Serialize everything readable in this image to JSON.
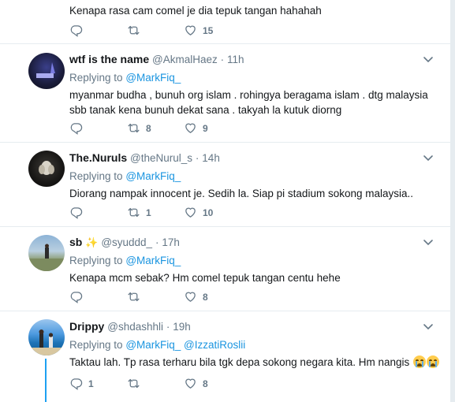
{
  "tweets": [
    {
      "text": "Kenapa rasa cam comel je dia tepuk tangan hahahah",
      "replies": "",
      "retweets": "",
      "likes": "15"
    },
    {
      "name": "wtf is the name",
      "handle": "@AkmalHaez",
      "dot": "·",
      "time": "11h",
      "replying_label": "Replying to",
      "mention1": "@MarkFiq_",
      "text": "myanmar budha , bunuh org islam . rohingya beragama islam . dtg malaysia sbb tanak kena bunuh dekat sana . takyah la kutuk diorng",
      "replies": "",
      "retweets": "8",
      "likes": "9"
    },
    {
      "name": "The.Nuruls",
      "handle": "@theNurul_s",
      "dot": "·",
      "time": "14h",
      "replying_label": "Replying to",
      "mention1": "@MarkFiq_",
      "text": "Diorang nampak innocent je. Sedih la. Siap pi stadium sokong malaysia..",
      "replies": "",
      "retweets": "1",
      "likes": "10"
    },
    {
      "name": "sb",
      "handle": "@syuddd_",
      "dot": "·",
      "time": "17h",
      "replying_label": "Replying to",
      "mention1": "@MarkFiq_",
      "text": "Kenapa mcm sebak? Hm comel tepuk tangan centu hehe",
      "replies": "",
      "retweets": "",
      "likes": "8"
    },
    {
      "name": "Drippy",
      "handle": "@shdashhli",
      "dot": "·",
      "time": "19h",
      "replying_label": "Replying to",
      "mention1": "@MarkFiq_",
      "mention2": "@IzzatiRoslii",
      "text": "Taktau lah. Tp rasa terharu bila tgk depa sokong negara kita. Hm nangis",
      "replies": "1",
      "retweets": "",
      "likes": "8"
    }
  ],
  "icons": {
    "reply": "reply-icon",
    "retweet": "retweet-icon",
    "like": "heart-icon",
    "more": "chevron-down-icon",
    "sparkle": "sparkles-icon",
    "emoji": "loudly-crying-face-icon"
  },
  "colors": {
    "accent": "#1da1f2",
    "link": "#1b95e0",
    "muted": "#657786",
    "divider": "#e6ecf0"
  }
}
